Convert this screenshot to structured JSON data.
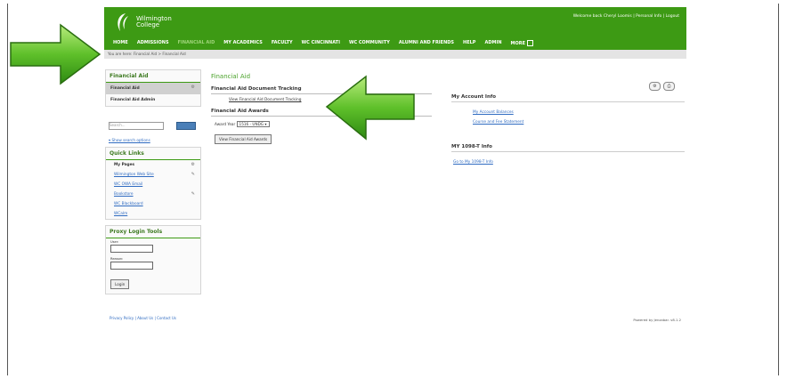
{
  "header": {
    "brand_line1": "Wilmington",
    "brand_line2": "College",
    "welcome": "Welcome back Cheryl Loomis | Personal Info | Logout"
  },
  "nav": [
    {
      "label": "HOME"
    },
    {
      "label": "ADMISSIONS"
    },
    {
      "label": "FINANCIAL AID"
    },
    {
      "label": "MY ACADEMICS"
    },
    {
      "label": "FACULTY"
    },
    {
      "label": "WC CINCINNATI"
    },
    {
      "label": "WC COMMUNITY"
    },
    {
      "label": "ALUMNI AND FRIENDS"
    },
    {
      "label": "HELP"
    },
    {
      "label": "ADMIN"
    },
    {
      "label": "MORE"
    }
  ],
  "breadcrumb": "You are here: Financial Aid > Financial Aid",
  "sidebar": {
    "fa_title": "Financial Aid",
    "fa_items": [
      "Financial Aid",
      "Financial Aid Admin"
    ],
    "search_placeholder": "Search...",
    "show_search_options": "Show search options",
    "quick_title": "Quick Links",
    "quick_links": [
      "My Pages",
      "Wilmington Web Site",
      "WC OWA Email",
      "Bookstore",
      "WC Blackboard",
      "WCalm"
    ],
    "proxy_title": "Proxy Login Tools",
    "user_label": "User:",
    "reason_label": "Reason:",
    "login_button": "Login"
  },
  "main": {
    "title": "Financial Aid",
    "doc_tracking_heading": "Financial Aid Document Tracking",
    "doc_tracking_link": "View Financial Aid Document Tracking",
    "awards_heading": "Financial Aid Awards",
    "award_year_label": "Award Year",
    "award_year_value": "1516 - UNDG",
    "view_awards_button": "View Financial Aid Awards"
  },
  "right": {
    "account_heading": "My Account Info",
    "account_links": [
      "My Account Balances",
      "Course and Fee Statement"
    ],
    "tax_heading": "MY 1098-T Info",
    "tax_link": "Go to My 1098-T Info"
  },
  "footer": {
    "links": "Privacy Policy | About Us | Contact Us",
    "powered": "Powered by Jenzabar. v8.1.2"
  },
  "colors": {
    "header_green": "#3d9a14",
    "accent_green": "#4aa22a",
    "link_blue": "#2f6bc1"
  }
}
